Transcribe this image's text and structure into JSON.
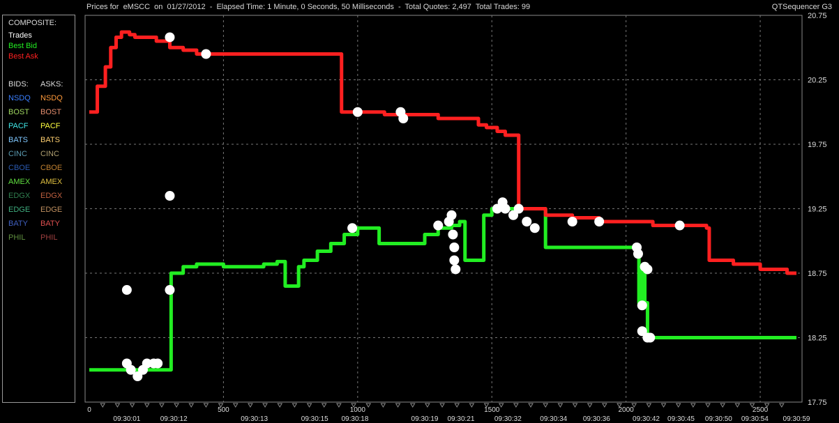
{
  "header": {
    "title": "Prices for  eMSCC  on  01/27/2012  -  Elapsed Time: 1 Minute, 0 Seconds, 50 Milliseconds  -  Total Quotes: 2,497  Total Trades: 99",
    "app_name": "QTSequencer G3"
  },
  "legend": {
    "composite_heading": "COMPOSITE:",
    "composite_items": [
      {
        "label": "Trades",
        "color": "#ffffff"
      },
      {
        "label": "Best Bid",
        "color": "#22ee22"
      },
      {
        "label": "Best Ask",
        "color": "#ff2020"
      }
    ],
    "bids_heading": "BIDS:",
    "asks_heading": "ASKS:",
    "exchanges": [
      {
        "bid": "NSDQ",
        "ask": "NSDQ",
        "bid_color": "#3a7fff",
        "ask_color": "#ff9a3a"
      },
      {
        "bid": "BOST",
        "ask": "BOST",
        "bid_color": "#a0d860",
        "ask_color": "#e89070"
      },
      {
        "bid": "PACF",
        "ask": "PACF",
        "bid_color": "#40e8e8",
        "ask_color": "#ffff40"
      },
      {
        "bid": "BATS",
        "ask": "BATS",
        "bid_color": "#80c8ff",
        "ask_color": "#ffd070"
      },
      {
        "bid": "CINC",
        "ask": "CINC",
        "bid_color": "#5a9ab0",
        "ask_color": "#b0a070"
      },
      {
        "bid": "CBOE",
        "ask": "CBOE",
        "bid_color": "#2a5ab0",
        "ask_color": "#c08030"
      },
      {
        "bid": "AMEX",
        "ask": "AMEX",
        "bid_color": "#60e040",
        "ask_color": "#e0c040"
      },
      {
        "bid": "EDGX",
        "ask": "EDGX",
        "bid_color": "#308050",
        "ask_color": "#c06040"
      },
      {
        "bid": "EDGE",
        "ask": "EDGE",
        "bid_color": "#40b080",
        "ask_color": "#c09060"
      },
      {
        "bid": "BATY",
        "ask": "BATY",
        "bid_color": "#4060c0",
        "ask_color": "#e05050"
      },
      {
        "bid": "PHIL",
        "ask": "PHIL",
        "bid_color": "#609040",
        "ask_color": "#a04040"
      }
    ]
  },
  "chart_data": {
    "type": "line",
    "title": "",
    "xlabel": "",
    "ylabel": "",
    "xlim": [
      0,
      2635
    ],
    "ylim": [
      17.75,
      20.75
    ],
    "y_ticks": [
      17.75,
      18.25,
      18.75,
      19.25,
      19.75,
      20.25,
      20.75
    ],
    "y_grid": [
      18.25,
      18.75,
      19.25,
      19.75,
      20.25
    ],
    "x_ticks": [
      0,
      500,
      1000,
      1500,
      2000,
      2500
    ],
    "x_grid": [
      500,
      1000,
      1500,
      2000,
      2500
    ],
    "time_labels": [
      {
        "x": 140,
        "label": "09:30:01"
      },
      {
        "x": 315,
        "label": "09:30:12"
      },
      {
        "x": 615,
        "label": "09:30:13"
      },
      {
        "x": 840,
        "label": "09:30:15"
      },
      {
        "x": 990,
        "label": "09:30:18"
      },
      {
        "x": 1250,
        "label": "09:30:19"
      },
      {
        "x": 1385,
        "label": "09:30:21"
      },
      {
        "x": 1560,
        "label": "09:30:32"
      },
      {
        "x": 1730,
        "label": "09:30:34"
      },
      {
        "x": 1890,
        "label": "09:30:36"
      },
      {
        "x": 2075,
        "label": "09:30:42"
      },
      {
        "x": 2205,
        "label": "09:30:45"
      },
      {
        "x": 2345,
        "label": "09:30:50"
      },
      {
        "x": 2480,
        "label": "09:30:54"
      },
      {
        "x": 2635,
        "label": "09:30:59"
      }
    ],
    "series": [
      {
        "name": "Best Bid",
        "color": "#22ee22",
        "x": [
          0,
          150,
          300,
          305,
          350,
          400,
          500,
          520,
          600,
          650,
          700,
          730,
          780,
          800,
          850,
          900,
          950,
          1000,
          1050,
          1080,
          1100,
          1130,
          1200,
          1250,
          1300,
          1350,
          1380,
          1400,
          1420,
          1450,
          1470,
          1500,
          1600,
          1650,
          1700,
          1780,
          1850,
          1900,
          2000,
          2045,
          2048,
          2060,
          2065,
          2070,
          2080,
          2100,
          2200,
          2300,
          2400,
          2500,
          2600,
          2635
        ],
        "y": [
          18.0,
          18.0,
          18.0,
          18.75,
          18.8,
          18.82,
          18.8,
          18.8,
          18.8,
          18.82,
          18.84,
          18.65,
          18.8,
          18.85,
          18.92,
          18.98,
          19.05,
          19.1,
          19.1,
          18.98,
          18.98,
          18.98,
          18.98,
          19.05,
          19.1,
          19.12,
          19.15,
          18.85,
          18.85,
          18.85,
          19.2,
          19.25,
          19.25,
          19.25,
          18.95,
          18.95,
          18.95,
          18.95,
          18.95,
          18.95,
          18.52,
          18.78,
          18.78,
          18.52,
          18.25,
          18.25,
          18.25,
          18.25,
          18.25,
          18.25,
          18.25,
          18.25
        ]
      },
      {
        "name": "Best Ask",
        "color": "#ff2020",
        "x": [
          0,
          30,
          60,
          80,
          100,
          120,
          130,
          150,
          170,
          200,
          250,
          300,
          350,
          400,
          500,
          800,
          930,
          940,
          1000,
          1100,
          1200,
          1300,
          1400,
          1450,
          1480,
          1520,
          1550,
          1570,
          1600,
          1700,
          1800,
          1900,
          2000,
          2100,
          2200,
          2300,
          2310,
          2400,
          2500,
          2600,
          2635
        ],
        "y": [
          20.0,
          20.2,
          20.35,
          20.5,
          20.58,
          20.62,
          20.62,
          20.6,
          20.58,
          20.58,
          20.55,
          20.5,
          20.48,
          20.45,
          20.45,
          20.45,
          20.45,
          20.0,
          20.0,
          19.98,
          19.98,
          19.95,
          19.95,
          19.9,
          19.88,
          19.85,
          19.82,
          19.82,
          19.25,
          19.2,
          19.18,
          19.15,
          19.15,
          19.12,
          19.12,
          19.1,
          18.85,
          18.82,
          18.78,
          18.75,
          18.75
        ]
      }
    ],
    "trades": [
      {
        "x": 140,
        "y": 18.62
      },
      {
        "x": 140,
        "y": 18.05
      },
      {
        "x": 155,
        "y": 18.0
      },
      {
        "x": 180,
        "y": 17.95
      },
      {
        "x": 200,
        "y": 18.0
      },
      {
        "x": 215,
        "y": 18.05
      },
      {
        "x": 240,
        "y": 18.05
      },
      {
        "x": 255,
        "y": 18.05
      },
      {
        "x": 300,
        "y": 18.62
      },
      {
        "x": 300,
        "y": 19.35
      },
      {
        "x": 300,
        "y": 20.58
      },
      {
        "x": 435,
        "y": 20.45
      },
      {
        "x": 980,
        "y": 19.1
      },
      {
        "x": 1000,
        "y": 20.0
      },
      {
        "x": 1160,
        "y": 20.0
      },
      {
        "x": 1170,
        "y": 19.95
      },
      {
        "x": 1300,
        "y": 19.12
      },
      {
        "x": 1340,
        "y": 19.15
      },
      {
        "x": 1350,
        "y": 19.2
      },
      {
        "x": 1355,
        "y": 19.05
      },
      {
        "x": 1360,
        "y": 18.95
      },
      {
        "x": 1360,
        "y": 18.85
      },
      {
        "x": 1365,
        "y": 18.78
      },
      {
        "x": 1520,
        "y": 19.25
      },
      {
        "x": 1540,
        "y": 19.3
      },
      {
        "x": 1550,
        "y": 19.25
      },
      {
        "x": 1580,
        "y": 19.2
      },
      {
        "x": 1600,
        "y": 19.25
      },
      {
        "x": 1630,
        "y": 19.15
      },
      {
        "x": 1660,
        "y": 19.1
      },
      {
        "x": 1800,
        "y": 19.15
      },
      {
        "x": 1900,
        "y": 19.15
      },
      {
        "x": 2040,
        "y": 18.95
      },
      {
        "x": 2045,
        "y": 18.9
      },
      {
        "x": 2070,
        "y": 18.8
      },
      {
        "x": 2080,
        "y": 18.78
      },
      {
        "x": 2060,
        "y": 18.5
      },
      {
        "x": 2060,
        "y": 18.3
      },
      {
        "x": 2080,
        "y": 18.25
      },
      {
        "x": 2090,
        "y": 18.25
      },
      {
        "x": 2200,
        "y": 19.12
      }
    ]
  }
}
